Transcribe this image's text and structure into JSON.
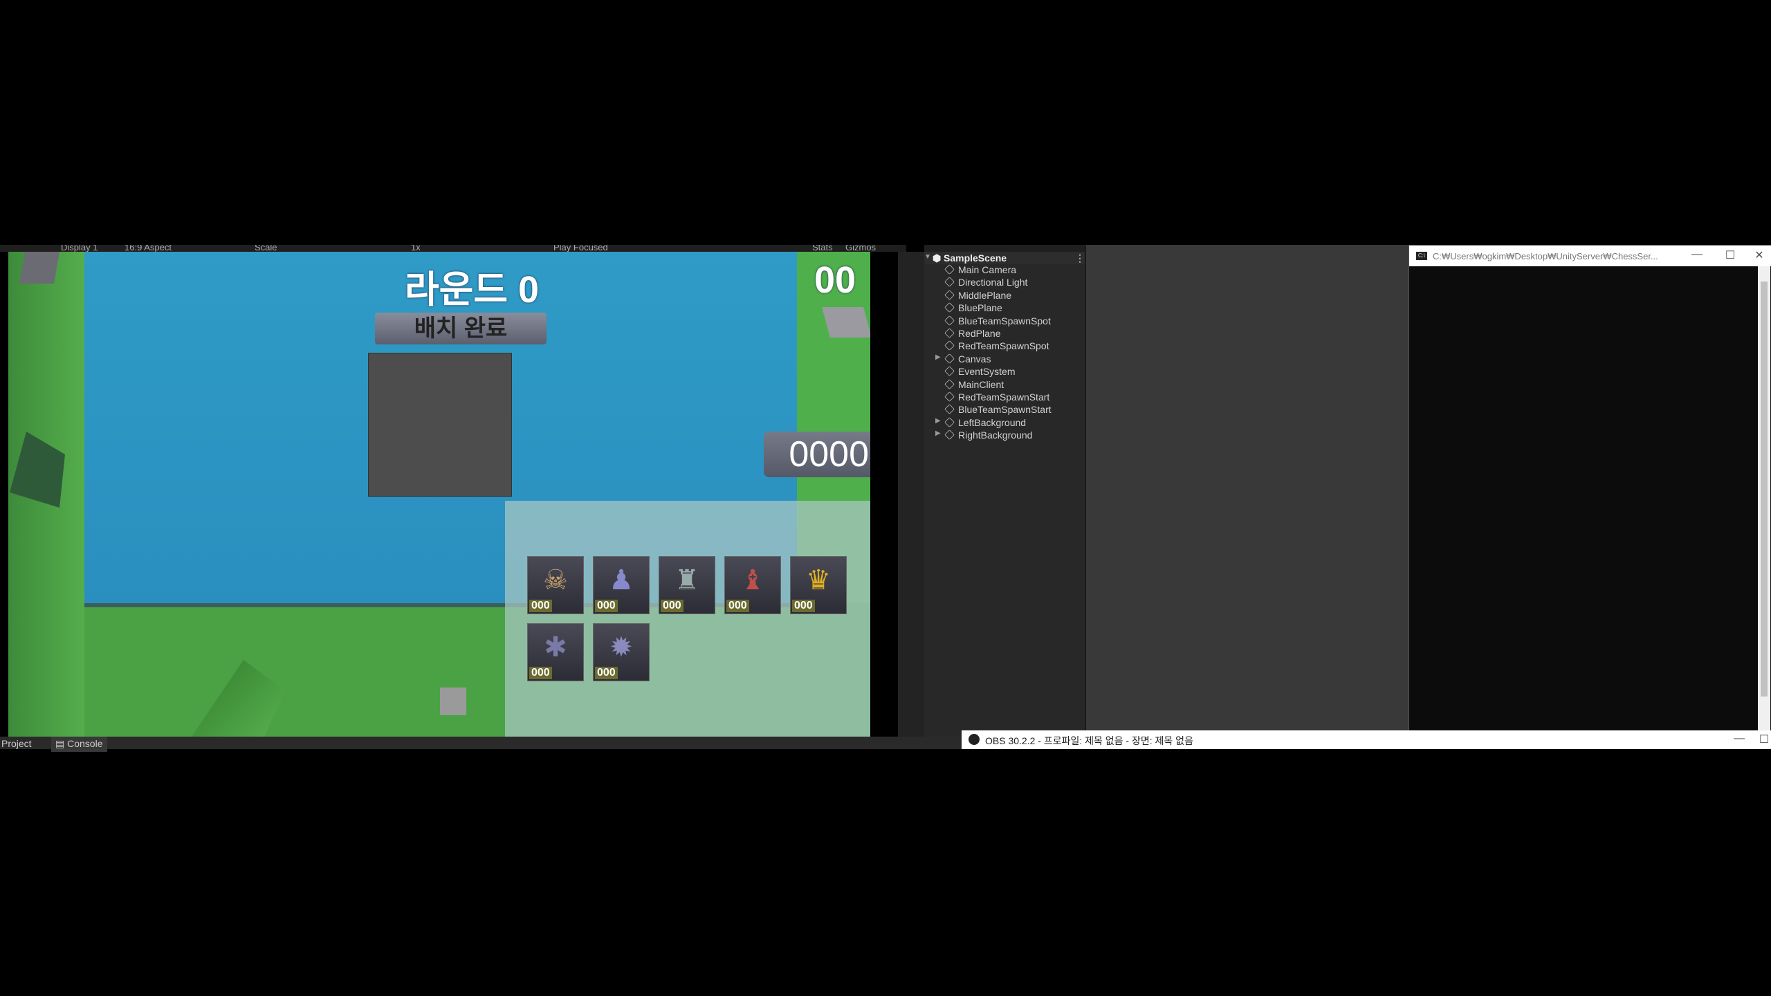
{
  "game_toolbar": {
    "labels": [
      "Display 1",
      "16:9 Aspect",
      "Scale",
      "1x",
      "Play Focused",
      "Stats",
      "Gizmos"
    ]
  },
  "game": {
    "round_title": "라운드 0",
    "timer": "00",
    "ready_button": "배치 완료",
    "gold": "0000",
    "units": [
      {
        "icon": "skeleton-warrior-icon",
        "count": "000"
      },
      {
        "icon": "hooded-mage-icon",
        "count": "000"
      },
      {
        "icon": "armored-knight-icon",
        "count": "000"
      },
      {
        "icon": "dark-archer-icon",
        "count": "000"
      },
      {
        "icon": "yellow-creature-icon",
        "count": "000"
      },
      {
        "icon": "spider-icon",
        "count": "000"
      },
      {
        "icon": "spiked-orb-icon",
        "count": "000"
      }
    ]
  },
  "bottom_tabs": {
    "project": "Project",
    "console": "Console"
  },
  "hierarchy": {
    "scene": "SampleScene",
    "items": [
      {
        "label": "Main Camera",
        "expandable": false
      },
      {
        "label": "Directional Light",
        "expandable": false
      },
      {
        "label": "MiddlePlane",
        "expandable": false
      },
      {
        "label": "BluePlane",
        "expandable": false
      },
      {
        "label": "BlueTeamSpawnSpot",
        "expandable": false
      },
      {
        "label": "RedPlane",
        "expandable": false
      },
      {
        "label": "RedTeamSpawnSpot",
        "expandable": false
      },
      {
        "label": "Canvas",
        "expandable": true
      },
      {
        "label": "EventSystem",
        "expandable": false
      },
      {
        "label": "MainClient",
        "expandable": false
      },
      {
        "label": "RedTeamSpawnStart",
        "expandable": false
      },
      {
        "label": "BlueTeamSpawnStart",
        "expandable": false
      },
      {
        "label": "LeftBackground",
        "expandable": true
      },
      {
        "label": "RightBackground",
        "expandable": true
      }
    ]
  },
  "cmd": {
    "title": "C:₩Users₩ogkim₩Desktop₩UnityServer₩ChessSer...",
    "min": "—",
    "max": "☐",
    "close": "✕"
  },
  "obs": {
    "title": "OBS 30.2.2 - 프로파일: 제목 없음 - 장면: 제목 없음",
    "min": "—",
    "max": "☐"
  }
}
